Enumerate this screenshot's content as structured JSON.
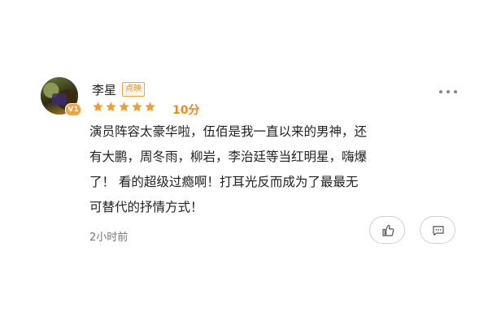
{
  "comment": {
    "username": "李星",
    "user_tag": "点映",
    "avatar_badge": "V1",
    "rating_stars": 5,
    "score": "10分",
    "text_lines": [
      "演员阵容太豪华啦，伍佰是我一直以来的男神，还",
      "有大鹏，周冬雨，柳岩，李治廷等当红明星，嗨爆",
      "了！ 看的超级过瘾啊！打耳光反而成为了最最无",
      "可替代的抒情方式！"
    ],
    "time": "2小时前"
  },
  "colors": {
    "star": "#f39c2f",
    "accent": "#e8892a",
    "text": "#222222",
    "muted": "#777777"
  },
  "icons": {
    "more": "more-horizontal-icon",
    "like": "thumbs-up-icon",
    "reply": "comment-bubble-icon"
  }
}
